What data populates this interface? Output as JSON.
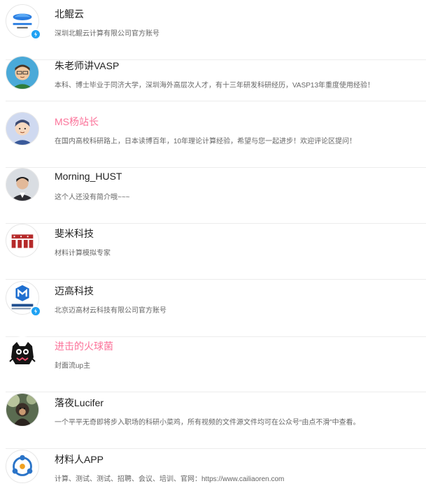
{
  "users": [
    {
      "name": "北鲲云",
      "desc": "深圳北鲲云计算有限公司官方账号",
      "verified": true,
      "highlight": false,
      "avatar_icon": "beikun-cloud-logo-icon"
    },
    {
      "name": "朱老师讲VASP",
      "desc": "本科、博士毕业于同济大学，深圳海外高层次人才，有十三年研发科研经历，VASP13年重度使用经验！",
      "verified": false,
      "highlight": false,
      "avatar_icon": "cartoon-teacher-icon"
    },
    {
      "name": "MS杨站长",
      "desc": "在国内高校科研路上，日本读博百年，10年理论计算经验，希望与您一起进步！欢迎评论区提问！",
      "verified": false,
      "highlight": true,
      "avatar_icon": "cartoon-man-icon"
    },
    {
      "name": "Morning_HUST",
      "desc": "这个人还没有简介哦~~~",
      "verified": false,
      "highlight": false,
      "avatar_icon": "man-photo-icon"
    },
    {
      "name": "斐米科技",
      "desc": "材料计算模拟专家",
      "verified": false,
      "highlight": false,
      "avatar_icon": "fm-logo-icon"
    },
    {
      "name": "迈高科技",
      "desc": "北京迈高材云科技有限公司官方账号",
      "verified": true,
      "highlight": false,
      "avatar_icon": "maigao-logo-icon"
    },
    {
      "name": "进击的火球菌",
      "desc": "封面流up主",
      "verified": false,
      "highlight": true,
      "avatar_icon": "black-creature-icon"
    },
    {
      "name": "落夜Lucifer",
      "desc": "一个平平无奇即将步入职场的科研小菜鸡，所有视频的文件源文件均可在公众号“由点不滑”中查看。",
      "verified": false,
      "highlight": false,
      "avatar_icon": "monkey-photo-icon"
    },
    {
      "name": "材料人APP",
      "desc": "计算、测试、测试、招聘、会议、培训、官网：https://www.cailiaoren.com",
      "verified": false,
      "highlight": false,
      "avatar_icon": "cailiaoren-logo-icon"
    }
  ],
  "colors": {
    "highlight": "#fb7299",
    "verified": "#1ea1f3",
    "divider": "#ececec"
  }
}
